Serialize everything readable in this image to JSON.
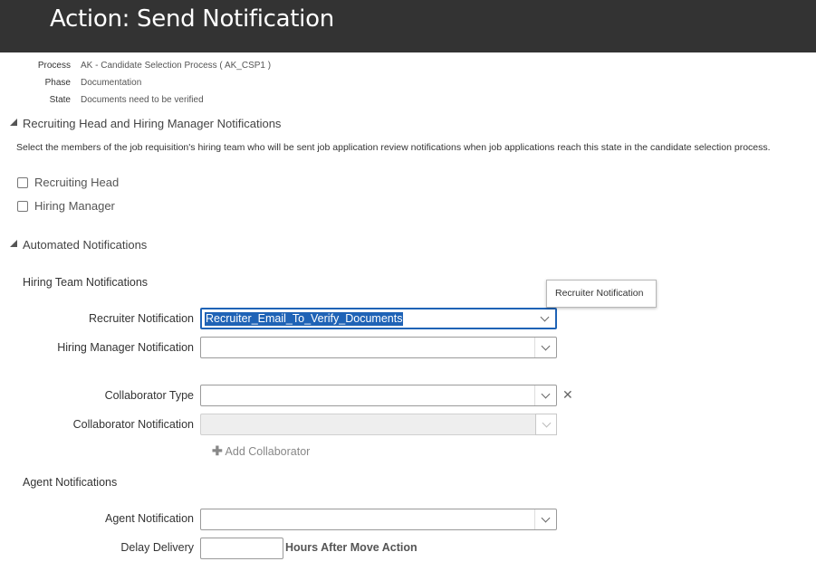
{
  "header": {
    "title": "Action: Send Notification"
  },
  "info": [
    {
      "label": "Process",
      "value": "AK - Candidate Selection Process ( AK_CSP1 )"
    },
    {
      "label": "Phase",
      "value": "Documentation"
    },
    {
      "label": "State",
      "value": "Documents need to be verified"
    }
  ],
  "recruiting_section": {
    "title": "Recruiting Head and Hiring Manager Notifications",
    "description": "Select the members of the job requisition's hiring team who will be sent job application review notifications when job applications reach this state in the candidate selection process.",
    "checkboxes": [
      {
        "label": "Recruiting Head",
        "checked": false
      },
      {
        "label": "Hiring Manager",
        "checked": false
      }
    ]
  },
  "automated_section": {
    "title": "Automated Notifications",
    "hiring_team": {
      "title": "Hiring Team Notifications",
      "recruiter_label": "Recruiter Notification",
      "recruiter_value": "Recruiter_Email_To_Verify_Documents",
      "hiring_manager_label": "Hiring Manager Notification",
      "hiring_manager_value": "",
      "collab_type_label": "Collaborator Type",
      "collab_type_value": "",
      "collab_notif_label": "Collaborator Notification",
      "collab_notif_value": "",
      "add_collaborator": "Add Collaborator",
      "add_icon": "plus-icon"
    },
    "agent": {
      "title": "Agent Notifications",
      "agent_label": "Agent Notification",
      "agent_value": "",
      "delay_label": "Delay Delivery",
      "delay_value": "",
      "hours_label": "Hours After Move Action"
    }
  },
  "tooltip": {
    "text": "Recruiter Notification"
  },
  "colors": {
    "header_bg": "#333333",
    "focus_blue": "#1f63b6"
  }
}
